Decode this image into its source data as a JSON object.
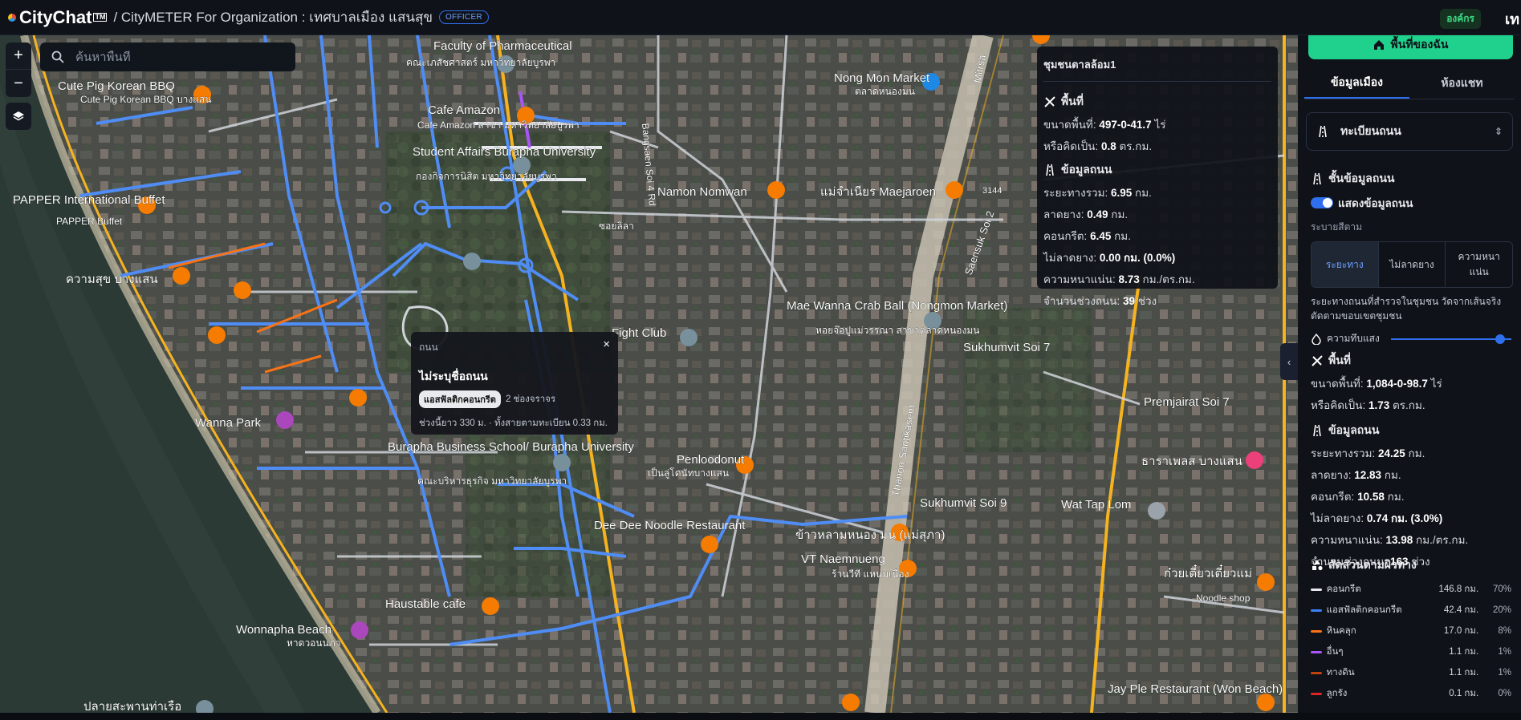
{
  "header": {
    "logo_text": "CityChat",
    "logo_sup": "TM",
    "breadcrumb": "/ CityMETER For Organization : เทศบาลเมือง แสนสุข",
    "role_badge": "OFFICER",
    "org_badge": "องค์กร",
    "cut_text": "เท"
  },
  "map": {
    "search_placeholder": "ค้นหาพื้นที่",
    "zoom_in": "+",
    "zoom_out": "−",
    "labels": [
      "Faculty of Pharmaceutical",
      "คณะเภสัชศาสตร์ มหาวิทยาลัยบูรพา",
      "Cafe Amazon",
      "Cafe Amazon สาขา มหาวิทยาลัยบูรพา",
      "Cute Pig Korean BBQ",
      "Cute Pig Korean BBQ บางแสน",
      "Student Affairs Burapha University",
      "กองกิจการนิสิต มหาวิทยาลัยบูรพา",
      "PAPPER International Buffet",
      "PAPPER Buffet",
      "ความสุข บางแสน",
      "Nong Mon Market",
      "ตลาดหนองมน",
      "Namon Nomwan",
      "แม่จำเนียร Maejaroen",
      "ซอยลิลา",
      "Fight Club",
      "Mae Wanna Crab Ball (Nongmon Market)",
      "หอยจ๊อปูแม่วรรณา สาขาตลาดหนองมน",
      "Sukhumvit Soi 7",
      "Premjairat Soi 7",
      "Wanna Park",
      "Burapha Business School/ Burapha University",
      "คณะบริหารธุรกิจ มหาวิทยาลัยบูรพา",
      "Penloodonut",
      "เป็นลู่โดนัทบางแสน",
      "Thanon Santikasem",
      "Sukhumvit Soi 9",
      "ธาราเพลส บางแสน",
      "Wat Tap Lom",
      "Dee Dee Noodle Restaurant",
      "ข้าวหลามหนอง มน (แม่สุภา)",
      "VT Naemnueng",
      "ร้านวีที แหนมเนือง",
      "Haustable cafe",
      "Wonnapha Beach",
      "หาดวอนนภา",
      "ก๋วยเตี๋ยวเตี๋ยวแม่",
      "Noodle shop",
      "Jay Ple Restaurant (Won Beach)",
      "ปลายสะพานท่าเรือ",
      "Saensuk Soi 2",
      "Mitrsa",
      "Bangsaen Soi 4 Rd",
      "3144"
    ]
  },
  "community_card": {
    "title": "ชุมชนตาลล้อม1",
    "area_heading": "พื้นที่",
    "area_size_label": "ขนาดพื้นที่:",
    "area_size_value": "497-0-41.7",
    "area_size_unit": "ไร่",
    "area_equiv_label": "หรือคิดเป็น:",
    "area_equiv_value": "0.8",
    "area_equiv_unit": "ตร.กม.",
    "road_heading": "ข้อมูลถนน",
    "total_label": "ระยะทางรวม:",
    "total_value": "6.95",
    "total_unit": "กม.",
    "asphalt_label": "ลาดยาง:",
    "asphalt_value": "0.49",
    "asphalt_unit": "กม.",
    "concrete_label": "คอนกรีต:",
    "concrete_value": "6.45",
    "concrete_unit": "กม.",
    "unpaved_label": "ไม่ลาดยาง:",
    "unpaved_value": "0.00 กม. (0.0%)",
    "density_label": "ความหนาแน่น:",
    "density_value": "8.73",
    "density_unit": "กม./ตร.กม.",
    "segments_label": "จำนวนช่วงถนน:",
    "segments_value": "39",
    "segments_unit": "ช่วง"
  },
  "road_popup": {
    "header": "ถนน",
    "close": "×",
    "name": "ไม่ระบุชื่อถนน",
    "surface_tag": "แอสฟัลติกคอนกรีต",
    "lanes": "2 ช่องจราจร",
    "length_text": "ช่วงนี้ยาว 330 ม. · ทั้งสายตามทะเบียน 0.33 กม."
  },
  "panel": {
    "home_button": "พื้นที่ของฉัน",
    "tab_city": "ข้อมูลเมือง",
    "tab_chat": "ห้องแชท",
    "selector_label": "ทะเบียนถนน",
    "layer_heading": "ชั้นข้อมูลถนน",
    "show_toggle": "แสดงข้อมูลถนน",
    "color_legend": "ระบายสีตาม",
    "seg_distance": "ระยะทาง",
    "seg_unpaved": "ไม่ลาดยาง",
    "seg_density": "ความหนาแน่น",
    "note": "ระยะทางถนนที่สำรวจในชุมชน วัดจากเส้นจริง ตัดตามขอบเขตชุมชน",
    "opacity_label": "ความทึบแสง",
    "opacity_value": 0.95,
    "area_heading": "พื้นที่",
    "area_size_label": "ขนาดพื้นที่:",
    "area_size_value": "1,084-0-98.7",
    "area_size_unit": "ไร่",
    "area_equiv_label": "หรือคิดเป็น:",
    "area_equiv_value": "1.73",
    "area_equiv_unit": "ตร.กม.",
    "road_heading": "ข้อมูลถนน",
    "total_label": "ระยะทางรวม:",
    "total_value": "24.25",
    "total_unit": "กม.",
    "asphalt_label": "ลาดยาง:",
    "asphalt_value": "12.83",
    "asphalt_unit": "กม.",
    "concrete_label": "คอนกรีต:",
    "concrete_value": "10.58",
    "concrete_unit": "กม.",
    "unpaved_label": "ไม่ลาดยาง:",
    "unpaved_value": "0.74 กม. (3.0%)",
    "density_label": "ความหนาแน่น:",
    "density_value": "13.98",
    "density_unit": "กม./ตร.กม.",
    "segments_label": "จำนวนช่วงถนน:",
    "segments_value": "163",
    "segments_unit": "ช่วง",
    "surface_heading": "สัดส่วนตามผิวทาง",
    "surfaces": [
      {
        "name": "คอนกรีต",
        "km": "146.8 กม.",
        "pct": "70%",
        "color": "#e6e8ec"
      },
      {
        "name": "แอสฟัลติกคอนกรีต",
        "km": "42.4 กม.",
        "pct": "20%",
        "color": "#3b82f6"
      },
      {
        "name": "หินคลุก",
        "km": "17.0 กม.",
        "pct": "8%",
        "color": "#f97316"
      },
      {
        "name": "อื่นๆ",
        "km": "1.1 กม.",
        "pct": "1%",
        "color": "#a855f7"
      },
      {
        "name": "ทางดิน",
        "km": "1.1 กม.",
        "pct": "1%",
        "color": "#c2410c"
      },
      {
        "name": "ลูกรัง",
        "km": "0.1 กม.",
        "pct": "0%",
        "color": "#dc2626"
      }
    ]
  }
}
